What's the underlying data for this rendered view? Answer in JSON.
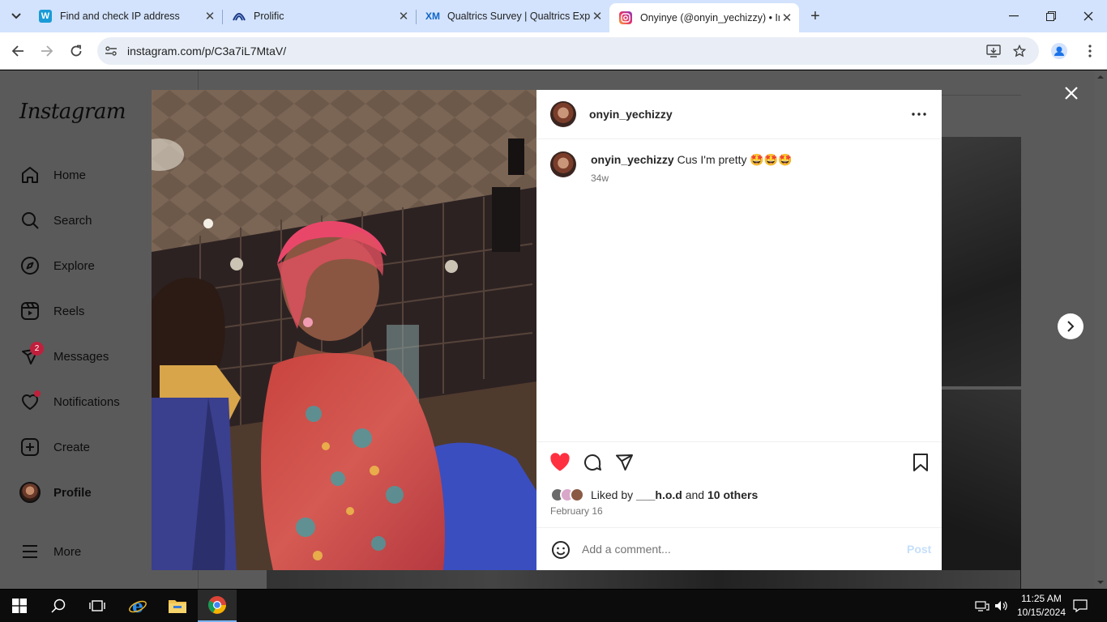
{
  "browser": {
    "tabs": [
      {
        "title": "Find and check IP address",
        "favicon": "W"
      },
      {
        "title": "Prolific",
        "favicon": "prolific-icon"
      },
      {
        "title": "Qualtrics Survey | Qualtrics Exp...",
        "favicon": "XM"
      },
      {
        "title": "Onyinye (@onyin_yechizzy) • In...",
        "favicon": "instagram-icon",
        "active": true
      }
    ],
    "url": "instagram.com/p/C3a7iL7MtaV/"
  },
  "instagram": {
    "logo": "Instagram",
    "nav": [
      {
        "label": "Home",
        "icon": "home-icon"
      },
      {
        "label": "Search",
        "icon": "search-icon"
      },
      {
        "label": "Explore",
        "icon": "compass-icon"
      },
      {
        "label": "Reels",
        "icon": "reels-icon"
      },
      {
        "label": "Messages",
        "icon": "messages-icon",
        "badge": "2"
      },
      {
        "label": "Notifications",
        "icon": "heart-icon"
      },
      {
        "label": "Create",
        "icon": "plus-square-icon"
      },
      {
        "label": "Profile",
        "icon": "avatar"
      },
      {
        "label": "More",
        "icon": "menu-icon"
      }
    ]
  },
  "post": {
    "username": "onyin_yechizzy",
    "caption_user": "onyin_yechizzy",
    "caption_text": "Cus I'm pretty 🤩🤩🤩",
    "caption_time": "34w",
    "liked_by_prefix": "Liked by ",
    "liked_by_user": "___h.o.d",
    "liked_by_and": " and ",
    "liked_by_others": "10 others",
    "date": "February 16",
    "comment_placeholder": "Add a comment...",
    "post_label": "Post",
    "like_color": "#ff3040"
  },
  "taskbar": {
    "time": "11:25 AM",
    "date": "10/15/2024"
  }
}
